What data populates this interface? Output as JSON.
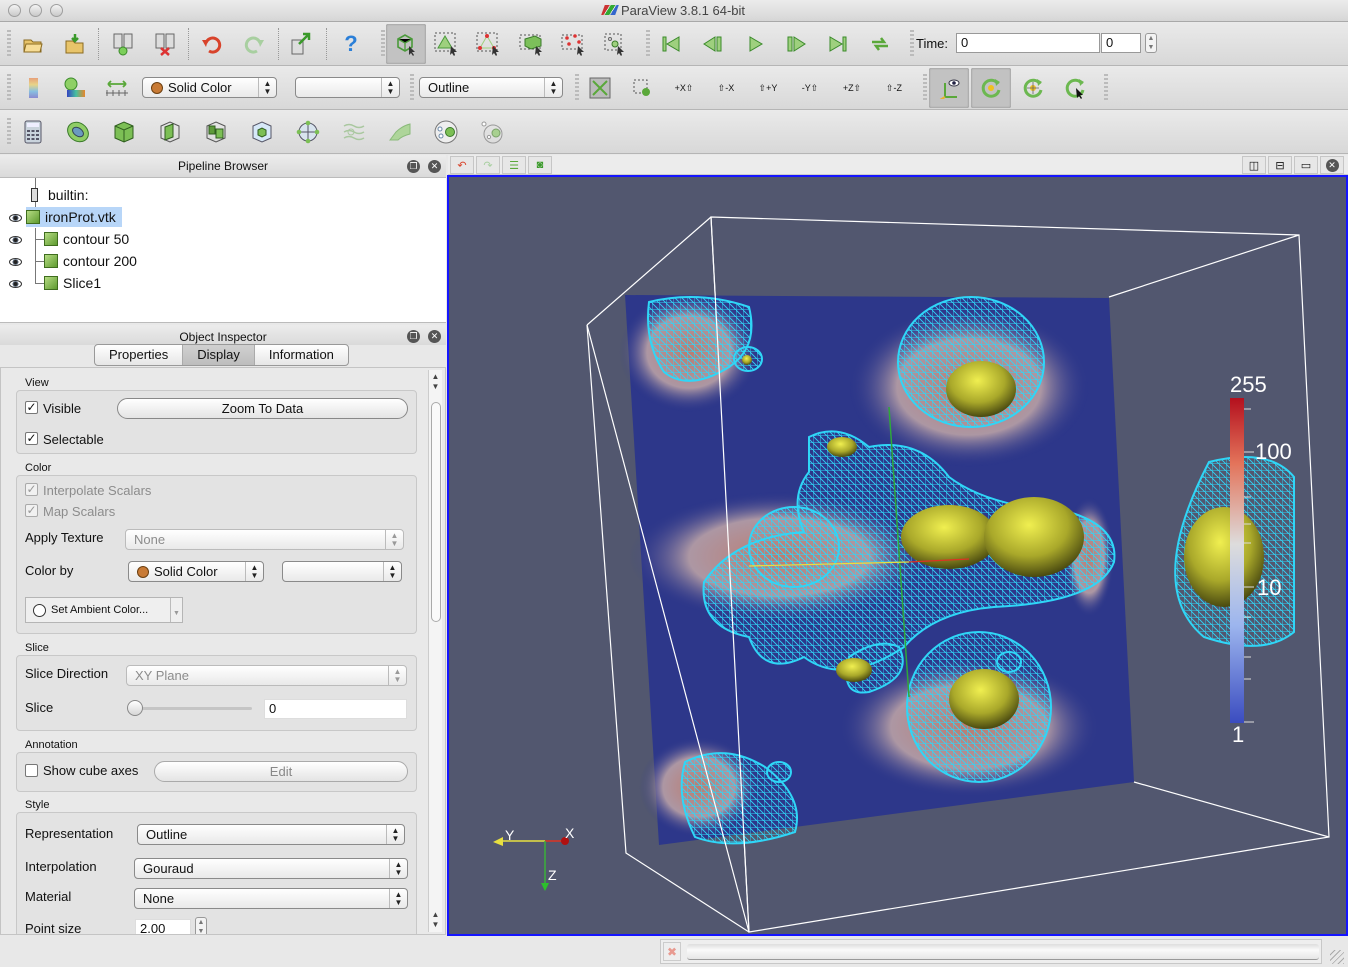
{
  "window": {
    "title": "ParaView 3.8.1 64-bit"
  },
  "toolbar_main": {
    "buttons": [
      {
        "name": "open-file",
        "icon": "folder-open-icon"
      },
      {
        "name": "load-state",
        "icon": "folder-load-icon"
      },
      {
        "name": "connect-server",
        "icon": "server-connect-icon"
      },
      {
        "name": "disconnect-server",
        "icon": "server-disconnect-icon"
      },
      {
        "name": "undo",
        "icon": "undo-icon"
      },
      {
        "name": "redo",
        "icon": "redo-icon"
      },
      {
        "name": "export",
        "icon": "export-icon"
      },
      {
        "name": "help",
        "icon": "help-icon"
      },
      {
        "name": "interact-mode",
        "icon": "cube-cursor-icon"
      },
      {
        "name": "select-cells-on",
        "icon": "select-cells-icon"
      },
      {
        "name": "select-points-on",
        "icon": "select-points-icon"
      },
      {
        "name": "select-cells-through",
        "icon": "select-frustum-cells-icon"
      },
      {
        "name": "select-points-through",
        "icon": "select-frustum-points-icon"
      },
      {
        "name": "select-block",
        "icon": "select-block-icon"
      }
    ],
    "vcr": [
      "first-frame-icon",
      "previous-frame-icon",
      "play-icon",
      "next-frame-icon",
      "last-frame-icon",
      "loop-icon"
    ],
    "time_label": "Time:",
    "time_value": "0",
    "time_index": "0"
  },
  "toolbar_display": {
    "color_by": "Solid Color",
    "color_component": "",
    "representation": "Outline",
    "camera_buttons": [
      "+X",
      "-X",
      "+Y",
      "-Y",
      "+Z",
      "-Z"
    ]
  },
  "toolbar_filters": {
    "icons": [
      "calculator-icon",
      "contour-icon",
      "clip-icon",
      "slice-icon",
      "threshold-icon",
      "extract-subset-icon",
      "glyph-icon",
      "stream-tracer-icon",
      "warp-icon",
      "group-datasets-icon",
      "extract-level-icon"
    ]
  },
  "pipeline_browser": {
    "title": "Pipeline Browser",
    "root": "builtin:",
    "items": [
      {
        "label": "ironProt.vtk",
        "selected": true,
        "visible": true
      },
      {
        "label": "contour 50",
        "selected": false,
        "visible": true
      },
      {
        "label": "contour 200",
        "selected": false,
        "visible": true
      },
      {
        "label": "Slice1",
        "selected": false,
        "visible": true
      }
    ]
  },
  "object_inspector": {
    "title": "Object Inspector",
    "tabs": [
      {
        "label": "Properties",
        "active": false
      },
      {
        "label": "Display",
        "active": true
      },
      {
        "label": "Information",
        "active": false
      }
    ],
    "view": {
      "section": "View",
      "visible_label": "Visible",
      "visible": true,
      "zoom_to_data": "Zoom To Data",
      "selectable_label": "Selectable",
      "selectable": true
    },
    "color": {
      "section": "Color",
      "interpolate_scalars": "Interpolate Scalars",
      "map_scalars": "Map Scalars",
      "apply_texture_label": "Apply Texture",
      "apply_texture_value": "None",
      "color_by_label": "Color by",
      "color_by_value": "Solid Color",
      "color_by_component": "",
      "ambient_color_button": "Set Ambient Color..."
    },
    "slice": {
      "section": "Slice",
      "direction_label": "Slice Direction",
      "direction_value": "XY Plane",
      "slice_label": "Slice",
      "slice_value": "0",
      "slider_fraction": 0
    },
    "annotation": {
      "section": "Annotation",
      "show_cube_axes": "Show cube axes",
      "show_cube_axes_checked": false,
      "edit_button": "Edit"
    },
    "style": {
      "section": "Style",
      "representation_label": "Representation",
      "representation_value": "Outline",
      "interpolation_label": "Interpolation",
      "interpolation_value": "Gouraud",
      "material_label": "Material",
      "material_value": "None",
      "point_size_label": "Point size",
      "point_size_value": "2.00"
    }
  },
  "render_view": {
    "background": "#52576f",
    "scalar_bar": {
      "max_label": "255",
      "mid_labels": [
        "100",
        "10"
      ],
      "min_label": "1"
    },
    "orientation_axes": {
      "x": "X",
      "y": "Y",
      "z": "Z"
    },
    "colors": {
      "outline": "#ffffff",
      "wireframe": "#2fd6f7",
      "isosurface": "#d3d23a",
      "slice_low": "#2d378a",
      "slice_high": "#c9826c"
    }
  },
  "view_buttons": [
    "split-horizontal-icon",
    "split-vertical-icon",
    "maximize-icon",
    "close-icon"
  ],
  "view_toolbar": [
    "camera-undo-icon",
    "camera-redo-icon",
    "view-settings-icon",
    "screenshot-icon"
  ]
}
